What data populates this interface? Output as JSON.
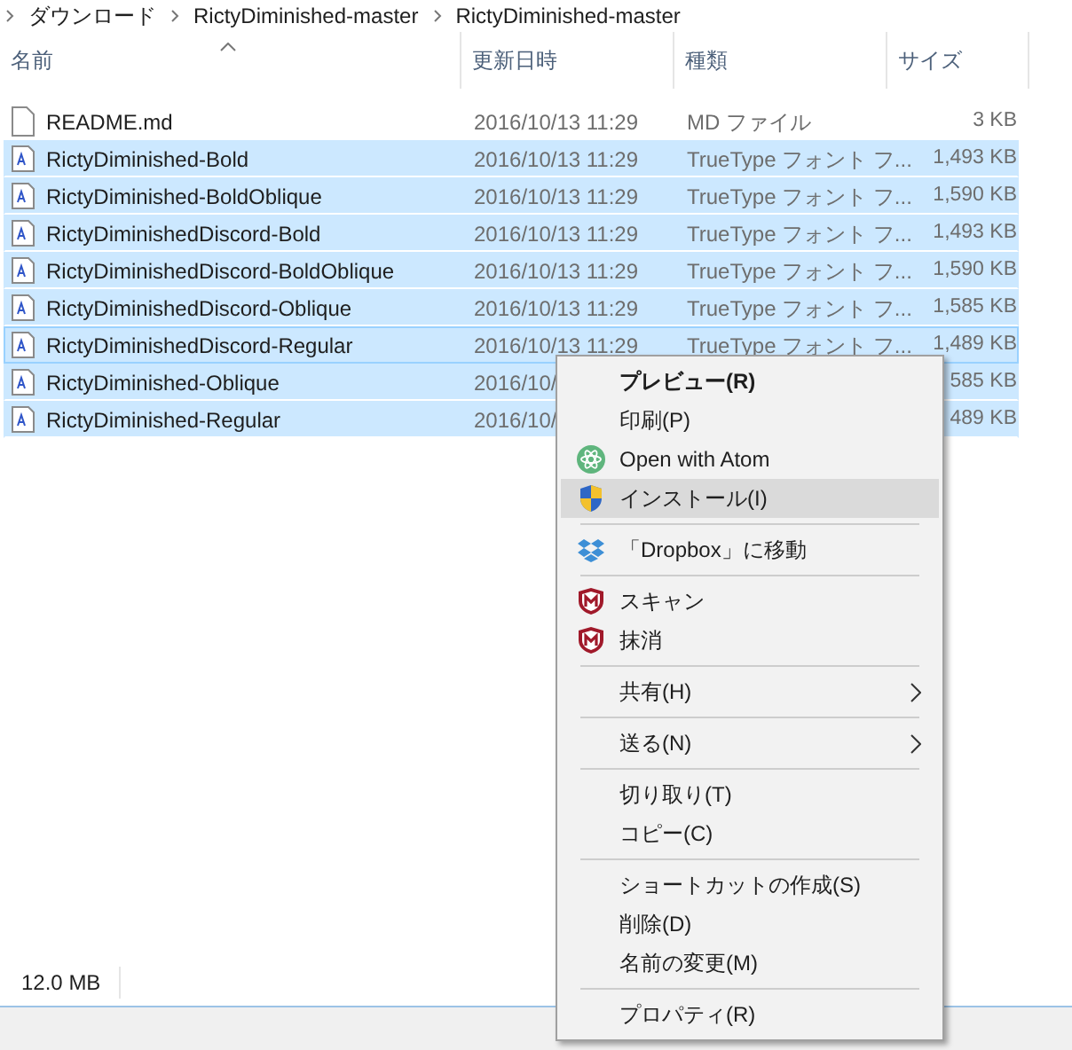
{
  "breadcrumb": [
    "ダウンロード",
    "RictyDiminished-master",
    "RictyDiminished-master"
  ],
  "columns": [
    "名前",
    "更新日時",
    "種類",
    "サイズ"
  ],
  "rows": [
    {
      "name": "README.md",
      "kind": "doc",
      "date": "2016/10/13 11:29",
      "type": "MD ファイル",
      "size": "3 KB",
      "selected": false,
      "focused": false
    },
    {
      "name": "RictyDiminished-Bold",
      "kind": "font",
      "date": "2016/10/13 11:29",
      "type": "TrueType フォント フ...",
      "size": "1,493 KB",
      "selected": true,
      "focused": false
    },
    {
      "name": "RictyDiminished-BoldOblique",
      "kind": "font",
      "date": "2016/10/13 11:29",
      "type": "TrueType フォント フ...",
      "size": "1,590 KB",
      "selected": true,
      "focused": false
    },
    {
      "name": "RictyDiminishedDiscord-Bold",
      "kind": "font",
      "date": "2016/10/13 11:29",
      "type": "TrueType フォント フ...",
      "size": "1,493 KB",
      "selected": true,
      "focused": false
    },
    {
      "name": "RictyDiminishedDiscord-BoldOblique",
      "kind": "font",
      "date": "2016/10/13 11:29",
      "type": "TrueType フォント フ...",
      "size": "1,590 KB",
      "selected": true,
      "focused": false
    },
    {
      "name": "RictyDiminishedDiscord-Oblique",
      "kind": "font",
      "date": "2016/10/13 11:29",
      "type": "TrueType フォント フ...",
      "size": "1,585 KB",
      "selected": true,
      "focused": false
    },
    {
      "name": "RictyDiminishedDiscord-Regular",
      "kind": "font",
      "date": "2016/10/13 11:29",
      "type": "TrueType フォント フ...",
      "size": "1,489 KB",
      "selected": true,
      "focused": true
    },
    {
      "name": "RictyDiminished-Oblique",
      "kind": "font",
      "date": "2016/10/",
      "size": "585 KB",
      "selected": true,
      "focused": false
    },
    {
      "name": "RictyDiminished-Regular",
      "kind": "font",
      "date": "2016/10/",
      "size": "489 KB",
      "selected": true,
      "focused": false
    }
  ],
  "status_bar": {
    "size": "12.0 MB"
  },
  "context_menu": [
    {
      "kind": "item",
      "label": "プレビュー(R)",
      "bold": true,
      "selected": false
    },
    {
      "kind": "item",
      "label": "印刷(P)",
      "selected": false
    },
    {
      "kind": "atom",
      "label": "Open with Atom",
      "selected": false
    },
    {
      "kind": "shield",
      "label": "インストール(I)",
      "selected": true
    },
    {
      "kind": "separator"
    },
    {
      "kind": "dropbox",
      "label": "「Dropbox」に移動",
      "selected": false
    },
    {
      "kind": "separator"
    },
    {
      "kind": "antivirus",
      "label": "スキャン",
      "selected": false
    },
    {
      "kind": "antivirus",
      "label": "抹消",
      "selected": false
    },
    {
      "kind": "separator"
    },
    {
      "kind": "item",
      "label": "共有(H)",
      "submenu": true,
      "selected": false
    },
    {
      "kind": "separator"
    },
    {
      "kind": "item",
      "label": "送る(N)",
      "submenu": true,
      "selected": false
    },
    {
      "kind": "separator"
    },
    {
      "kind": "item",
      "label": "切り取り(T)",
      "selected": false
    },
    {
      "kind": "item",
      "label": "コピー(C)",
      "selected": false
    },
    {
      "kind": "separator"
    },
    {
      "kind": "item",
      "label": "ショートカットの作成(S)",
      "selected": false
    },
    {
      "kind": "item",
      "label": "削除(D)",
      "selected": false
    },
    {
      "kind": "item",
      "label": "名前の変更(M)",
      "selected": false
    },
    {
      "kind": "separator"
    },
    {
      "kind": "item",
      "label": "プロパティ(R)",
      "selected": false
    }
  ]
}
